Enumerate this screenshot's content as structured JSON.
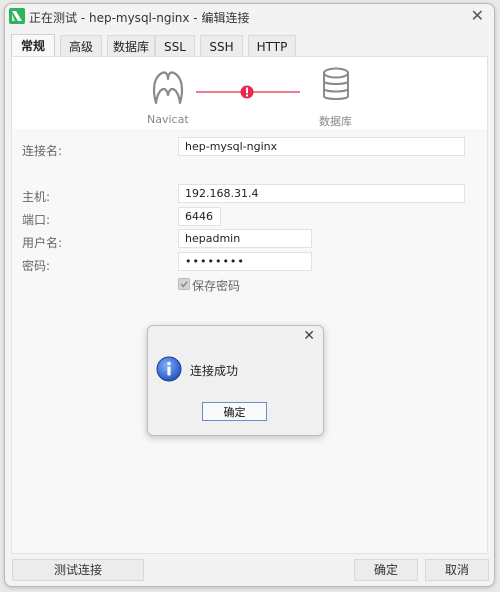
{
  "window": {
    "title": "正在测试 - hep-mysql-nginx - 编辑连接",
    "close_glyph": "✕"
  },
  "tabs": [
    {
      "label": "常规",
      "active": true
    },
    {
      "label": "高级"
    },
    {
      "label": "数据库"
    },
    {
      "label": "SSL"
    },
    {
      "label": "SSH"
    },
    {
      "label": "HTTP"
    }
  ],
  "diagram": {
    "left_node_label": "Navicat",
    "right_node_label": "数据库",
    "connector_color": "#f27c8f",
    "status_color": "#e8294d"
  },
  "form": {
    "connection_name_label": "连接名:",
    "connection_name_value": "hep-mysql-nginx",
    "host_label": "主机:",
    "host_value": "192.168.31.4",
    "port_label": "端口:",
    "port_value": "6446",
    "username_label": "用户名:",
    "username_value": "hepadmin",
    "password_label": "密码:",
    "password_value": "••••••••",
    "save_password_label": "保存密码",
    "save_password_checked": true
  },
  "dialog": {
    "close_glyph": "✕",
    "message": "连接成功",
    "ok_label": "确定"
  },
  "buttons": {
    "test_connection": "测试连接",
    "ok": "确定",
    "cancel": "取消"
  }
}
